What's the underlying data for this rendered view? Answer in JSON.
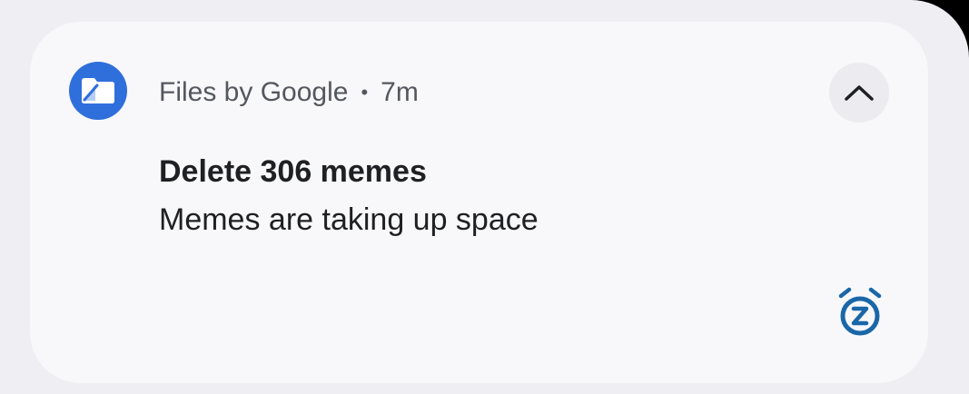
{
  "notification": {
    "app_name": "Files by Google",
    "separator": "•",
    "time": "7m",
    "title": "Delete 306 memes",
    "body": "Memes are taking up space"
  },
  "icons": {
    "app": "files-by-google-icon",
    "collapse": "chevron-up-icon",
    "snooze": "snooze-icon"
  },
  "colors": {
    "app_icon_bg": "#2f6fdb",
    "snooze_accent": "#1a67a8",
    "card_bg": "#f8f8fb",
    "screen_bg": "#efeef3"
  }
}
